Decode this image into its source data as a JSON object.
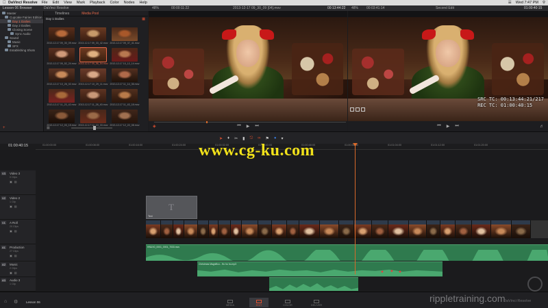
{
  "menubar": {
    "app": "DaVinci Resolve",
    "items": [
      "File",
      "Edit",
      "View",
      "Mark",
      "Playback",
      "Color",
      "Nodes",
      "Help"
    ],
    "clock": "Wed 7:47 PM"
  },
  "topbar": {
    "project": "Lesson 06 Browser",
    "browser_title": "DaVinci Resolve",
    "source_zoom": "48%",
    "source_tc": "00:00:11:22",
    "source_clip": "2013-12-17 09_30_09 [04].mov",
    "source_duration": "00:13:44:22",
    "record_zoom": "48%",
    "record_tc": "00:03:41:14",
    "timeline_name": "Second Edit",
    "record_duration": "01:00:40:15"
  },
  "bins": [
    {
      "label": "Master",
      "indent": 0
    },
    {
      "label": "Cupcake Fairies Edition",
      "indent": 1
    },
    {
      "label": "Day 1 Dailies",
      "indent": 2,
      "red": true,
      "active": true
    },
    {
      "label": "Day 2 Dailies",
      "indent": 2
    },
    {
      "label": "Closing Scene",
      "indent": 2
    },
    {
      "label": "Sync Audio",
      "indent": 3
    },
    {
      "label": "Sound",
      "indent": 1
    },
    {
      "label": "Music",
      "indent": 2
    },
    {
      "label": "SFX",
      "indent": 2
    },
    {
      "label": "Establishing Shots",
      "indent": 1
    }
  ],
  "media": {
    "tabs": [
      "Timelines",
      "Media Pool"
    ],
    "path": "Day 1 Dailies",
    "thumbs": [
      {
        "label": "2013-12-17 09_30_09.mov"
      },
      {
        "label": "2013-12-17 09_33_42.mov"
      },
      {
        "label": "2013-12-17 09_37_41.mov"
      },
      {
        "label": "2013-12-17 09_52_24.mov"
      },
      {
        "label": "2013-12-17 09_56_54.mov",
        "selected": true
      },
      {
        "label": "2013-12-17 10_12_14.mov"
      },
      {
        "label": "2013-12-17 10_26_02.mov"
      },
      {
        "label": "2013-12-17 10_29_11.mov"
      },
      {
        "label": "2013-12-17 11_14_36.mov"
      },
      {
        "label": "2013-12-17 11_23_42.mov"
      },
      {
        "label": "2013-12-17 11_28_40.mov"
      },
      {
        "label": "2013-12-17 11_43_18.mov"
      },
      {
        "label": "2013-12-17 12_03_15.mov"
      },
      {
        "label": "2013-12-17 12_10_33.mov"
      },
      {
        "label": "2013-12-17 12_22_08.mov"
      }
    ]
  },
  "record_overlay": {
    "line1": "SRC TC: 00:13:44:21/217",
    "line2": "REC TC: 01:00:40:15"
  },
  "timeline": {
    "current_tc": "01:00:40:15",
    "ruler_ticks": [
      "01:00:00:00",
      "01:00:08:00",
      "01:00:16:00",
      "01:00:24:00",
      "01:00:32:00",
      "01:00:40:00",
      "01:00:48:00",
      "01:00:56:00",
      "01:01:04:00",
      "01:01:12:00",
      "01:01:20:00"
    ],
    "tracks": [
      {
        "id": "V3",
        "name": "Video 3",
        "sub": "0 Clips"
      },
      {
        "id": "V2",
        "name": "Video 2",
        "sub": "1 Clip"
      },
      {
        "id": "V1",
        "name": "A Roll",
        "sub": "20 Clips"
      },
      {
        "id": "A1",
        "name": "Production",
        "sub": "27 Clips"
      },
      {
        "id": "A2",
        "name": "Music",
        "sub": "2 Clips"
      },
      {
        "id": "A3",
        "name": "Audio 3",
        "sub": "1 Clip"
      }
    ],
    "title_clip_label": "Text",
    "audio_a1_label": "HNUX0_0001_0001_7033.mov",
    "audio_a2_label": "Christmas Magnifico - Ho ho ho.mp3"
  },
  "bottom": {
    "project": "Lesson 06",
    "pages": [
      "MEDIA",
      "EDIT",
      "COLOR",
      "DELIVER"
    ],
    "active_page": "EDIT"
  },
  "watermark": "www.cg-ku.com",
  "ripple": {
    "logo": "rippletraining.com",
    "sub": "DaVinci Resolve"
  },
  "colors": {
    "accent": "#e05030",
    "playhead": "#d96a2a",
    "audio": "#2f7a4e",
    "watermark": "#f2e21a"
  }
}
